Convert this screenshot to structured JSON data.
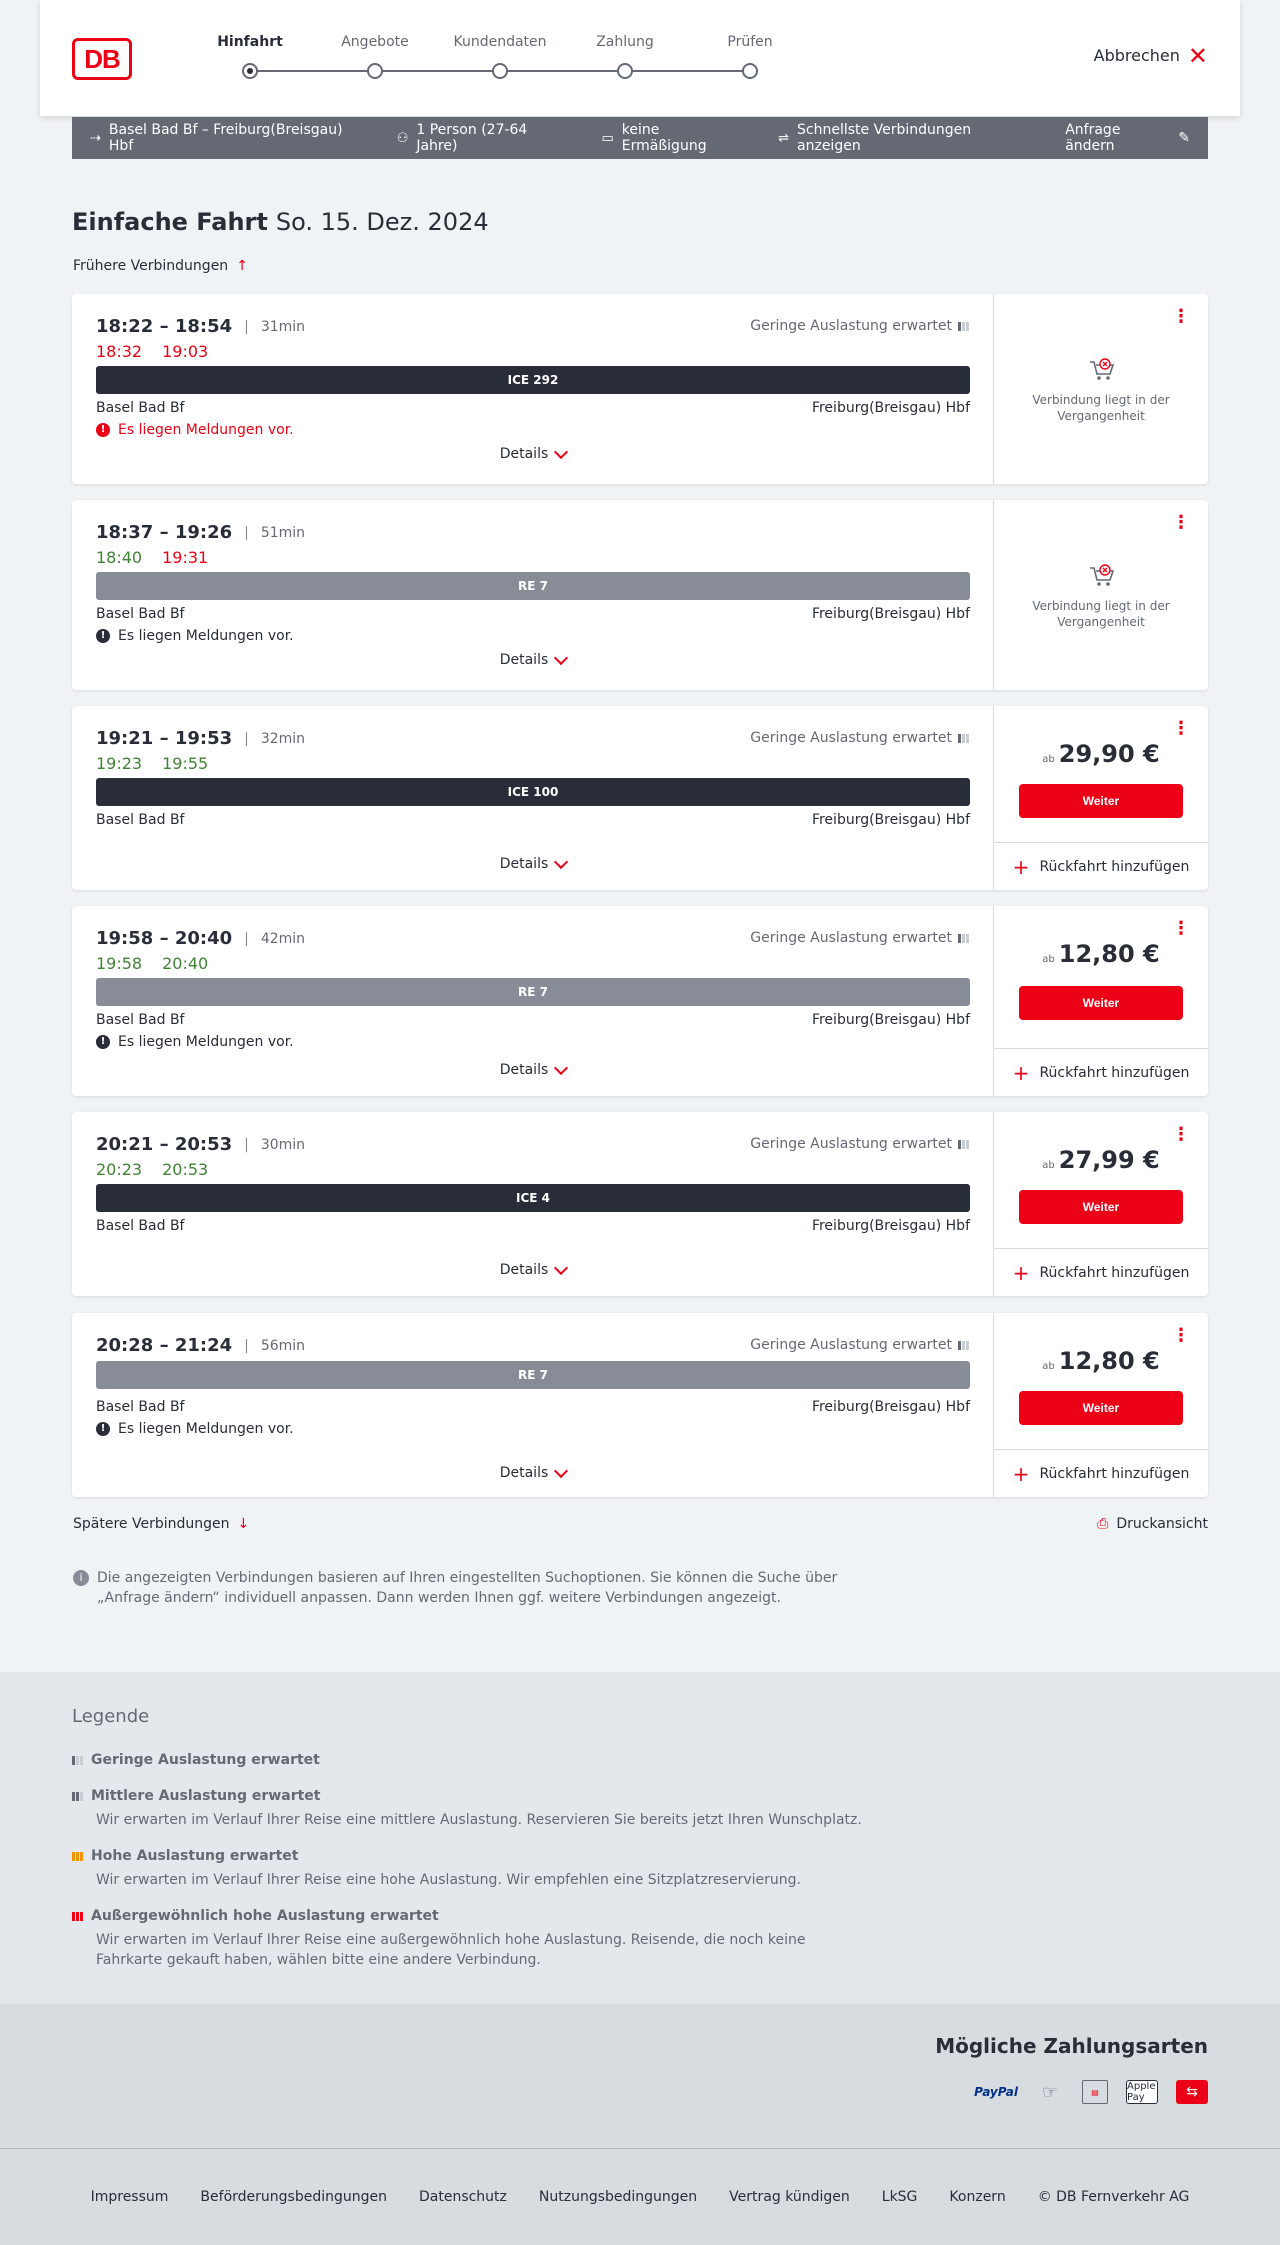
{
  "header": {
    "logo": "DB",
    "cancel": "Abbrechen",
    "steps": [
      "Hinfahrt",
      "Angebote",
      "Kundendaten",
      "Zahlung",
      "Prüfen"
    ]
  },
  "query": {
    "route": "Basel Bad Bf – Freiburg(Breisgau) Hbf",
    "persons": "1 Person (27-64 Jahre)",
    "discount": "keine Ermäßigung",
    "fastest": "Schnellste Verbindungen anzeigen",
    "edit": "Anfrage ändern"
  },
  "page": {
    "title": "Einfache Fahrt",
    "date": "So. 15. Dez. 2024",
    "earlier": "Frühere Verbindungen",
    "later": "Spätere Verbindungen",
    "print": "Druckansicht",
    "details": "Details",
    "return_trip": "Rückfahrt hinzufügen",
    "weiter": "Weiter",
    "ab": "ab",
    "past": "Verbindung liegt in der Vergangenheit",
    "load": "Geringe Auslastung erwartet",
    "info": "Die angezeigten Verbindungen basieren auf Ihren eingestellten Suchoptionen. Sie können die Suche über „Anfrage ändern“ individuell anpassen. Dann werden Ihnen ggf. weitere Verbindungen angezeigt."
  },
  "connections": [
    {
      "times": "18:22 – 18:54",
      "duration": "31min",
      "rt_dep": "18:32",
      "rt_arr": "19:03",
      "train": "ICE 292",
      "from": "Basel Bad Bf",
      "to": "Freiburg(Breisgau) Hbf",
      "message": "Es liegen Meldungen vor."
    },
    {
      "times": "18:37 – 19:26",
      "duration": "51min",
      "rt_dep": "18:40",
      "rt_arr": "19:31",
      "train": "RE 7",
      "from": "Basel Bad Bf",
      "to": "Freiburg(Breisgau) Hbf",
      "message": "Es liegen Meldungen vor."
    },
    {
      "times": "19:21 – 19:53",
      "duration": "32min",
      "rt_dep": "19:23",
      "rt_arr": "19:55",
      "train": "ICE 100",
      "from": "Basel Bad Bf",
      "to": "Freiburg(Breisgau) Hbf",
      "price": "29,90 €"
    },
    {
      "times": "19:58 – 20:40",
      "duration": "42min",
      "rt_dep": "19:58",
      "rt_arr": "20:40",
      "train": "RE 7",
      "from": "Basel Bad Bf",
      "to": "Freiburg(Breisgau) Hbf",
      "message": "Es liegen Meldungen vor.",
      "price": "12,80 €"
    },
    {
      "times": "20:21 – 20:53",
      "duration": "30min",
      "rt_dep": "20:23",
      "rt_arr": "20:53",
      "train": "ICE 4",
      "from": "Basel Bad Bf",
      "to": "Freiburg(Breisgau) Hbf",
      "price": "27,99 €"
    },
    {
      "times": "20:28 – 21:24",
      "duration": "56min",
      "train": "RE 7",
      "from": "Basel Bad Bf",
      "to": "Freiburg(Breisgau) Hbf",
      "message": "Es liegen Meldungen vor.",
      "price": "12,80 €"
    }
  ],
  "legend": {
    "title": "Legende",
    "items": [
      {
        "title": "Geringe Auslastung erwartet",
        "desc": ""
      },
      {
        "title": "Mittlere Auslastung erwartet",
        "desc": "Wir erwarten im Verlauf Ihrer Reise eine mittlere Auslastung. Reservieren Sie bereits jetzt Ihren Wunschplatz."
      },
      {
        "title": "Hohe Auslastung erwartet",
        "desc": "Wir erwarten im Verlauf Ihrer Reise eine hohe Auslastung. Wir empfehlen eine Sitzplatzreservierung."
      },
      {
        "title": "Außergewöhnlich hohe Auslastung erwartet",
        "desc": "Wir erwarten im Verlauf Ihrer Reise eine außergewöhnlich hohe Auslastung. Reisende, die noch keine Fahrkarte gekauft haben, wählen bitte eine andere Verbindung."
      }
    ]
  },
  "payments": {
    "title": "Mögliche Zahlungsarten",
    "methods": [
      "PayPal",
      "Apple Pay"
    ]
  },
  "footer": {
    "links": [
      "Impressum",
      "Beförderungsbedingungen",
      "Datenschutz",
      "Nutzungsbedingungen",
      "Vertrag kündigen",
      "LkSG",
      "Konzern",
      "© DB Fernverkehr AG"
    ]
  },
  "colors": {
    "brand": "#ec0016",
    "delay": "#ec0016",
    "ontime": "#408335",
    "ice": "#282d37",
    "re": "#878c96"
  }
}
